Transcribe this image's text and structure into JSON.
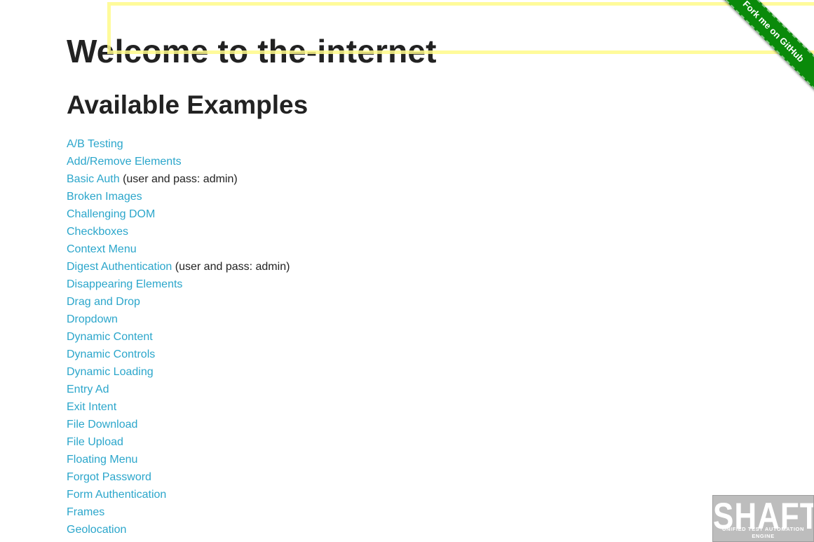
{
  "page": {
    "title": "Welcome to the-internet",
    "subtitle": "Available Examples"
  },
  "examples": [
    {
      "label": "A/B Testing",
      "note": ""
    },
    {
      "label": "Add/Remove Elements",
      "note": ""
    },
    {
      "label": "Basic Auth",
      "note": "(user and pass: admin)"
    },
    {
      "label": "Broken Images",
      "note": ""
    },
    {
      "label": "Challenging DOM",
      "note": ""
    },
    {
      "label": "Checkboxes",
      "note": ""
    },
    {
      "label": "Context Menu",
      "note": ""
    },
    {
      "label": "Digest Authentication",
      "note": "(user and pass: admin)"
    },
    {
      "label": "Disappearing Elements",
      "note": ""
    },
    {
      "label": "Drag and Drop",
      "note": ""
    },
    {
      "label": "Dropdown",
      "note": ""
    },
    {
      "label": "Dynamic Content",
      "note": ""
    },
    {
      "label": "Dynamic Controls",
      "note": ""
    },
    {
      "label": "Dynamic Loading",
      "note": ""
    },
    {
      "label": "Entry Ad",
      "note": ""
    },
    {
      "label": "Exit Intent",
      "note": ""
    },
    {
      "label": "File Download",
      "note": ""
    },
    {
      "label": "File Upload",
      "note": ""
    },
    {
      "label": "Floating Menu",
      "note": ""
    },
    {
      "label": "Forgot Password",
      "note": ""
    },
    {
      "label": "Form Authentication",
      "note": ""
    },
    {
      "label": "Frames",
      "note": ""
    },
    {
      "label": "Geolocation",
      "note": ""
    }
  ],
  "ribbon": {
    "label": "Fork me on GitHub"
  },
  "logo": {
    "name": "SHAFT",
    "tagline": "UNIFIED TEST AUTOMATION ENGINE"
  },
  "colors": {
    "link": "#2ba6cb",
    "ribbon": "#0a8a0a",
    "highlight": "#fffb8a"
  }
}
